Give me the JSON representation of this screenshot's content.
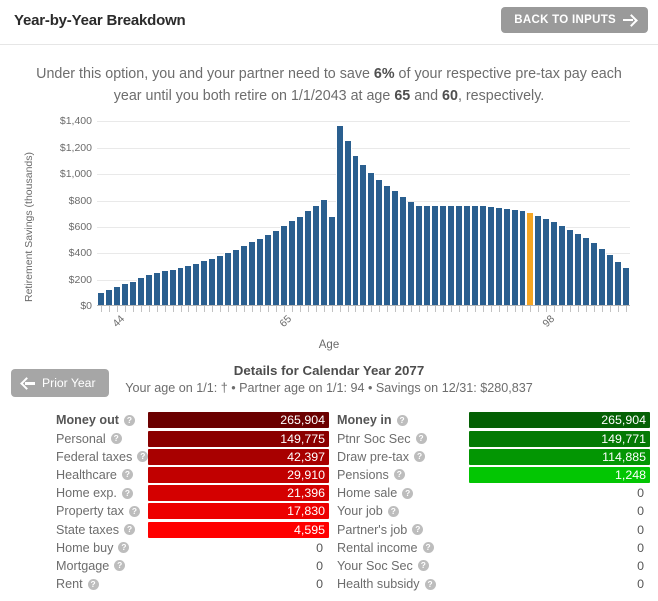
{
  "header": {
    "title": "Year-by-Year Breakdown",
    "back_button": "BACK TO INPUTS",
    "back_icon": "arrow-right-icon"
  },
  "description": {
    "line1_pre": "Under this option, you and your partner need to save ",
    "save_pct": "6%",
    "line1_post": " of your respective pre-tax pay each year",
    "line2_pre": "until you both retire on 1/1/2043 at age ",
    "age1": "65",
    "line2_mid": " and ",
    "age2": "60",
    "line2_post": ", respectively."
  },
  "chart_data": {
    "type": "bar",
    "title": "",
    "xlabel": "Age",
    "ylabel": "Retirement Savings (thousands)",
    "ylim": [
      0,
      1400
    ],
    "ytick_labels": [
      "$1,400",
      "$1,200",
      "$1,000",
      "$800",
      "$600",
      "$400",
      "$200",
      "$0"
    ],
    "ytick_values": [
      1400,
      1200,
      1000,
      800,
      600,
      400,
      200,
      0
    ],
    "grid": true,
    "legend": false,
    "xtick_labels": [
      "44",
      "65",
      "98"
    ],
    "xtick_indices": [
      0,
      21,
      54
    ],
    "categories": [
      44,
      45,
      46,
      47,
      48,
      49,
      50,
      51,
      52,
      53,
      54,
      55,
      56,
      57,
      58,
      59,
      60,
      61,
      62,
      63,
      64,
      65,
      66,
      67,
      68,
      69,
      70,
      71,
      72,
      73,
      74,
      75,
      76,
      77,
      78,
      79,
      80,
      81,
      82,
      83,
      84,
      85,
      86,
      87,
      88,
      89,
      90,
      91,
      92,
      93,
      94,
      95,
      96,
      97,
      98
    ],
    "values": [
      95,
      115,
      135,
      158,
      180,
      205,
      228,
      245,
      258,
      270,
      282,
      295,
      312,
      332,
      352,
      372,
      395,
      418,
      448,
      478,
      505,
      535,
      565,
      602,
      640,
      672,
      712,
      752,
      800,
      672,
      1355,
      1245,
      1130,
      1062,
      1000,
      952,
      905,
      862,
      820,
      782,
      752,
      748,
      748,
      748,
      748,
      748,
      750,
      752,
      748,
      742,
      740,
      730,
      722,
      712,
      698,
      678,
      655,
      630,
      600,
      572,
      540,
      510,
      470,
      430,
      380,
      330,
      281
    ],
    "highlight_index": 54,
    "bar_color": "#2a5f8f",
    "highlight_color": "#f5a623"
  },
  "details": {
    "prior_button": "Prior Year",
    "prior_icon": "arrow-left-icon",
    "title": "Details for Calendar Year 2077",
    "subtitle": "Your age on 1/1: † • Partner age on 1/1: 94 • Savings on 12/31: $280,837"
  },
  "money_out": {
    "rows": [
      {
        "label": "Money out",
        "value": "265,904",
        "bar_pct": 100,
        "color": "#6b0000",
        "zero": false
      },
      {
        "label": "Personal",
        "value": "149,775",
        "bar_pct": 100,
        "color": "#8a0000",
        "zero": false
      },
      {
        "label": "Federal taxes",
        "value": "42,397",
        "bar_pct": 100,
        "color": "#a80000",
        "zero": false
      },
      {
        "label": "Healthcare",
        "value": "29,910",
        "bar_pct": 100,
        "color": "#c10000",
        "zero": false
      },
      {
        "label": "Home exp.",
        "value": "21,396",
        "bar_pct": 100,
        "color": "#d40000",
        "zero": false
      },
      {
        "label": "Property tax",
        "value": "17,830",
        "bar_pct": 100,
        "color": "#ed0000",
        "zero": false
      },
      {
        "label": "State taxes",
        "value": "4,595",
        "bar_pct": 100,
        "color": "#ff0000",
        "zero": false
      },
      {
        "label": "Home buy",
        "value": "0",
        "bar_pct": 0,
        "color": "",
        "zero": true
      },
      {
        "label": "Mortgage",
        "value": "0",
        "bar_pct": 0,
        "color": "",
        "zero": true
      },
      {
        "label": "Rent",
        "value": "0",
        "bar_pct": 0,
        "color": "",
        "zero": true
      }
    ]
  },
  "money_in": {
    "rows": [
      {
        "label": "Money in",
        "value": "265,904",
        "bar_pct": 100,
        "color": "#046004",
        "zero": false
      },
      {
        "label": "Ptnr Soc Sec",
        "value": "149,771",
        "bar_pct": 100,
        "color": "#047a04",
        "zero": false
      },
      {
        "label": "Draw pre-tax",
        "value": "114,885",
        "bar_pct": 100,
        "color": "#039603",
        "zero": false
      },
      {
        "label": "Pensions",
        "value": "1,248",
        "bar_pct": 100,
        "color": "#03c603",
        "zero": false
      },
      {
        "label": "Home sale",
        "value": "0",
        "bar_pct": 0,
        "color": "",
        "zero": true
      },
      {
        "label": "Your job",
        "value": "0",
        "bar_pct": 0,
        "color": "",
        "zero": true
      },
      {
        "label": "Partner's job",
        "value": "0",
        "bar_pct": 0,
        "color": "",
        "zero": true
      },
      {
        "label": "Rental income",
        "value": "0",
        "bar_pct": 0,
        "color": "",
        "zero": true
      },
      {
        "label": "Your Soc Sec",
        "value": "0",
        "bar_pct": 0,
        "color": "",
        "zero": true
      },
      {
        "label": "Health subsidy",
        "value": "0",
        "bar_pct": 0,
        "color": "",
        "zero": true
      }
    ]
  },
  "icons": {
    "help": "?"
  }
}
